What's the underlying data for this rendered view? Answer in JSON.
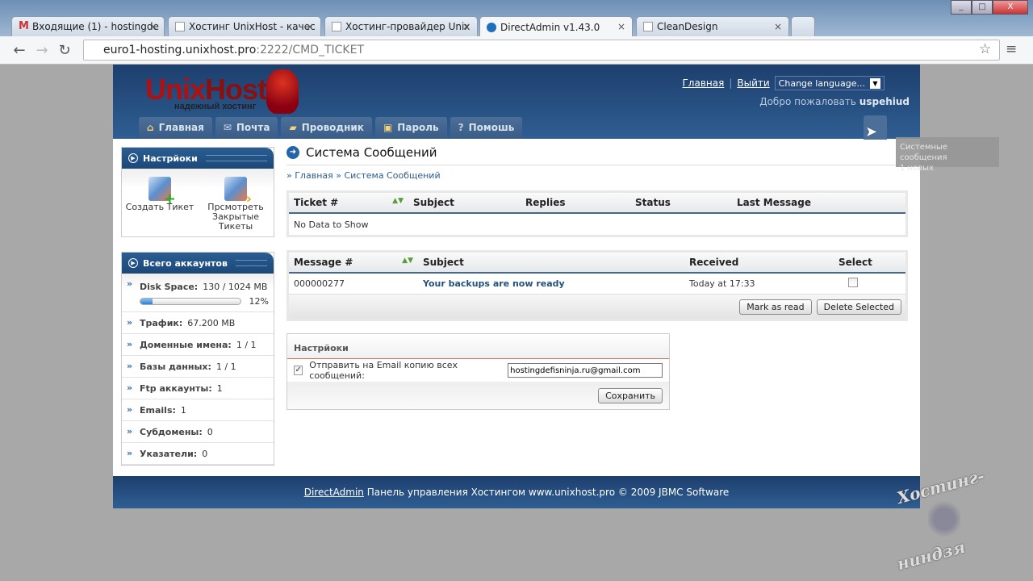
{
  "browser": {
    "tabs": [
      {
        "title": "Входящие (1) - hostingde",
        "icon": "gmail-icon"
      },
      {
        "title": "Хостинг UnixHost - качес",
        "icon": "page-icon"
      },
      {
        "title": "Хостинг-провайдер Unix",
        "icon": "page-icon"
      },
      {
        "title": "DirectAdmin v1.43.0",
        "icon": "globe-icon",
        "active": true
      },
      {
        "title": "CleanDesign",
        "icon": "page-icon"
      }
    ],
    "close_glyph": "×",
    "url_host": "euro1-hosting.unixhost.pro",
    "url_path": ":2222/CMD_TICKET"
  },
  "header": {
    "logo_main": "Unix",
    "logo_accent": "Host",
    "logo_tag": "надежный хостинг",
    "link_home": "Главная",
    "link_logout": "Выйти",
    "sep": "|",
    "language": "Change language...",
    "welcome": "Добро пожаловать",
    "username": "uspehiud",
    "nav": [
      {
        "label": "Главная",
        "icon": "house-icon"
      },
      {
        "label": "Почта",
        "icon": "mail-icon"
      },
      {
        "label": "Проводник",
        "icon": "folder-icon"
      },
      {
        "label": "Пароль",
        "icon": "key-icon"
      },
      {
        "label": "Помошь",
        "icon": "help-icon"
      }
    ],
    "tooltip_line1": "Системные сообщения",
    "tooltip_line2": "1 новых"
  },
  "sidebar": {
    "settings_title": "Настрйоки",
    "actions": [
      {
        "label": "Создать Тикет"
      },
      {
        "label": "Прсмотреть Закрытые Тикеты"
      }
    ],
    "accounts_title": "Всего аккаунтов",
    "disk_label": "Disk Space:",
    "disk_value": "130 / 1024 MB",
    "disk_percent": 12,
    "disk_percent_label": "12%",
    "stats": [
      {
        "label": "Трафик:",
        "value": "67.200 MB"
      },
      {
        "label": "Доменные имена:",
        "value": "1 / 1"
      },
      {
        "label": "Базы данных:",
        "value": "1 / 1"
      },
      {
        "label": "Ftp аккаунты:",
        "value": "1"
      },
      {
        "label": "Emails:",
        "value": "1"
      },
      {
        "label": "Субдомены:",
        "value": "0"
      },
      {
        "label": "Указатели:",
        "value": "0"
      }
    ]
  },
  "main": {
    "title": "Система Сообщений",
    "breadcrumb": "» Главная » Система Сообщений",
    "tickets": {
      "headers": [
        "Ticket #",
        "Subject",
        "Replies",
        "Status",
        "Last Message"
      ],
      "empty": "No Data to Show"
    },
    "messages": {
      "headers": [
        "Message #",
        "Subject",
        "Received",
        "Select"
      ],
      "rows": [
        {
          "id": "000000277",
          "subject": "Your backups are now ready",
          "received": "Today at 17:33"
        }
      ],
      "mark_read": "Mark as read",
      "delete": "Delete Selected"
    },
    "settings": {
      "title": "Настрйоки",
      "email_copy_label": "Отправить на Email копию всех сообщений:",
      "email": "hostingdefisninja.ru@gmail.com",
      "save": "Сохранить"
    }
  },
  "footer": {
    "link": "DirectAdmin",
    "text": " Панель управления Хостингом www.unixhost.pro © 2009 JBMC Software"
  },
  "watermark": "Хостинг-ниндзя"
}
